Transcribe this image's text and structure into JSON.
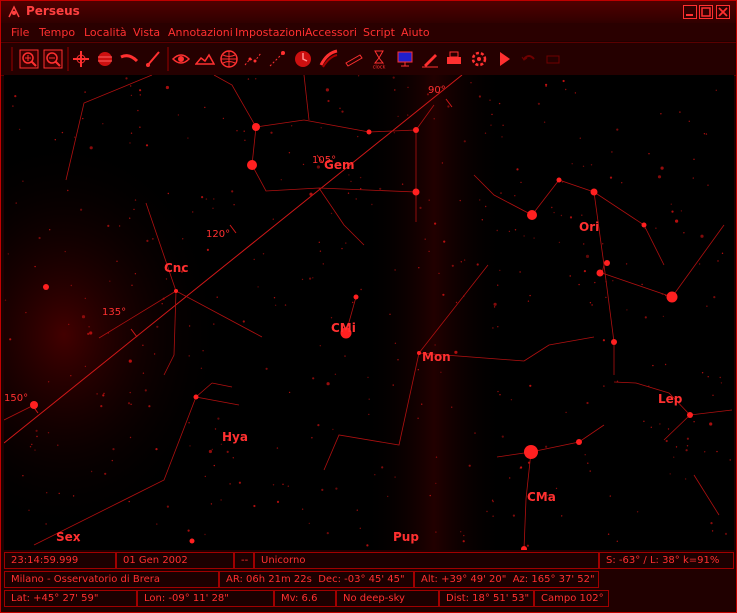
{
  "window": {
    "title": "Perseus",
    "colors": {
      "accent": "#ff3030",
      "background": "#000000",
      "chrome": "#2a0000"
    }
  },
  "menu": [
    "File",
    "Tempo",
    "Località",
    "Vista",
    "Annotazioni",
    "Impostazioni",
    "Accessori",
    "Script",
    "Aiuto"
  ],
  "toolbar": {
    "icons": [
      "zoom-in-icon",
      "zoom-out-icon",
      "crosshair-icon",
      "planet-icon",
      "comet-icon",
      "telescope-icon",
      "eye-icon",
      "horizon-icon",
      "grid-icon",
      "constellation-icon",
      "meteor-icon",
      "clock-icon",
      "milky-way-icon",
      "satellite-icon",
      "hourglass-icon",
      "monitor-icon",
      "edit-icon",
      "print-icon",
      "settings-icon",
      "play-icon",
      "undo-icon",
      "redo-icon"
    ],
    "clock_label": "clock"
  },
  "sky": {
    "constellations": [
      "Gem",
      "Ori",
      "Cnc",
      "CMi",
      "Mon",
      "Lep",
      "Hya",
      "CMa",
      "Sex",
      "Pup"
    ],
    "degree_marks": [
      "90°",
      "105°",
      "120°",
      "135°",
      "150°"
    ]
  },
  "status": {
    "time": "23:14:59.999",
    "date": "01 Gen 2002",
    "separator": "--",
    "constellation": "Unicorno",
    "scale": "S: -63° / L: 38° k=91%",
    "location": "Milano - Osservatorio di Brera",
    "ra": "AR: 06h 21m 22s",
    "dec": "Dec: -03° 45' 45\"",
    "alt": "Alt: +39° 49' 20\"",
    "az": "Az: 165° 37' 52\"",
    "lat": "Lat: +45° 27' 59\"",
    "lon": "Lon: -09° 11' 28\"",
    "mag": "Mv: 6.6",
    "deep_sky": "No deep-sky",
    "dist": "Dist: 18° 51' 53\"",
    "field": "Campo 102°"
  }
}
